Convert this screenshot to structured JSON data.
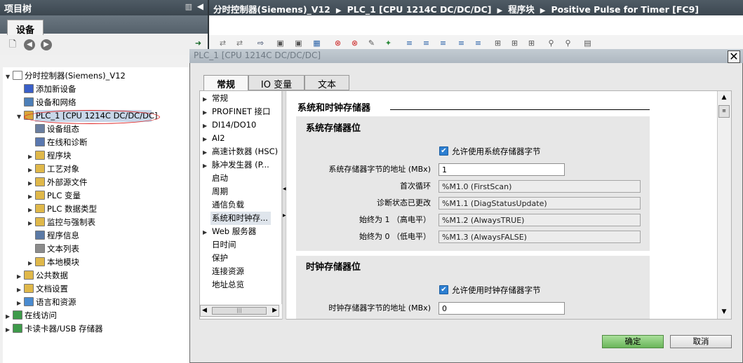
{
  "left_panel": {
    "title": "项目树",
    "tab": "设备",
    "tree": [
      {
        "label": "分时控制器(Siemens)_V12",
        "twisty": "▼",
        "color": "#ffffff"
      },
      {
        "label": "添加新设备",
        "twisty": "",
        "color": "#3a5fc8"
      },
      {
        "label": "设备和网络",
        "twisty": "",
        "color": "#4d7fb8"
      },
      {
        "label": "PLC_1 [CPU 1214C DC/DC/DC]",
        "twisty": "▼",
        "color": "#d9a63a"
      },
      {
        "label": "设备组态",
        "twisty": "",
        "color": "#6a7ea0"
      },
      {
        "label": "在线和诊断",
        "twisty": "",
        "color": "#5a78b0"
      },
      {
        "label": "程序块",
        "twisty": "▶",
        "color": "#e0b84a"
      },
      {
        "label": "工艺对象",
        "twisty": "▶",
        "color": "#e0b84a"
      },
      {
        "label": "外部源文件",
        "twisty": "▶",
        "color": "#e0b84a"
      },
      {
        "label": "PLC 变量",
        "twisty": "▶",
        "color": "#e0b84a"
      },
      {
        "label": "PLC 数据类型",
        "twisty": "▶",
        "color": "#e0b84a"
      },
      {
        "label": "监控与强制表",
        "twisty": "▶",
        "color": "#e0b84a"
      },
      {
        "label": "程序信息",
        "twisty": "",
        "color": "#5b7aa6"
      },
      {
        "label": "文本列表",
        "twisty": "",
        "color": "#8c8c8c"
      },
      {
        "label": "本地模块",
        "twisty": "▶",
        "color": "#e0b84a"
      },
      {
        "label": "公共数据",
        "twisty": "▶",
        "color": "#e0b84a"
      },
      {
        "label": "文档设置",
        "twisty": "▶",
        "color": "#e0b84a"
      },
      {
        "label": "语言和资源",
        "twisty": "▶",
        "color": "#4a8bd0"
      },
      {
        "label": "在线访问",
        "twisty": "▶",
        "color": "#3e9a4a"
      },
      {
        "label": "卡读卡器/USB 存储器",
        "twisty": "▶",
        "color": "#3e9a4a"
      }
    ]
  },
  "breadcrumb": [
    "分时控制器(Siemens)_V12",
    "PLC_1 [CPU 1214C DC/DC/DC]",
    "程序块",
    "Positive Pulse for Timer [FC9]"
  ],
  "dialog": {
    "title": "PLC_1 [CPU 1214C DC/DC/DC]",
    "tabs": [
      "常规",
      "IO 变量",
      "文本"
    ],
    "nav": [
      {
        "label": "常规",
        "arrow": "▶"
      },
      {
        "label": "PROFINET 接口",
        "arrow": "▶"
      },
      {
        "label": "DI14/DO10",
        "arrow": "▶"
      },
      {
        "label": "AI2",
        "arrow": "▶"
      },
      {
        "label": "高速计数器 (HSC)",
        "arrow": "▶"
      },
      {
        "label": "脉冲发生器 (P...",
        "arrow": "▶"
      },
      {
        "label": "启动",
        "arrow": ""
      },
      {
        "label": "周期",
        "arrow": ""
      },
      {
        "label": "通信负载",
        "arrow": ""
      },
      {
        "label": "系统和时钟存...",
        "arrow": ""
      },
      {
        "label": "Web 服务器",
        "arrow": "▶"
      },
      {
        "label": "日时间",
        "arrow": ""
      },
      {
        "label": "保护",
        "arrow": ""
      },
      {
        "label": "连接资源",
        "arrow": ""
      },
      {
        "label": "地址总览",
        "arrow": ""
      }
    ],
    "section_title": "系统和时钟存储器",
    "system_group": {
      "title": "系统存储器位",
      "enable_label": "允许使用系统存储器字节",
      "enable_checked": true,
      "address_label": "系统存储器字节的地址 (MBx)",
      "address_value": "1",
      "fields": [
        {
          "label": "首次循环",
          "value": "%M1.0 (FirstScan)"
        },
        {
          "label": "诊断状态已更改",
          "value": "%M1.1 (DiagStatusUpdate)"
        },
        {
          "label": "始终为 1 （高电平）",
          "value": "%M1.2 (AlwaysTRUE)"
        },
        {
          "label": "始终为 0 （低电平）",
          "value": "%M1.3 (AlwaysFALSE)"
        }
      ]
    },
    "clock_group": {
      "title": "时钟存储器位",
      "enable_label": "允许使用时钟存储器字节",
      "enable_checked": true,
      "address_label": "时钟存储器字节的地址 (MBx)",
      "address_value": "0"
    },
    "ok_label": "确定",
    "cancel_label": "取消"
  }
}
